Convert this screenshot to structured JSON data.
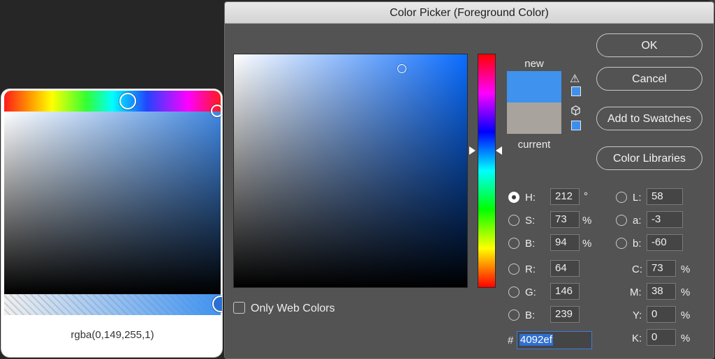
{
  "popover": {
    "value_text": "rgba(0,149,255,1)"
  },
  "dialog": {
    "title": "Color Picker (Foreground Color)",
    "buttons": {
      "ok": "OK",
      "cancel": "Cancel",
      "add_to_swatches": "Add to Swatches",
      "color_libraries": "Color Libraries"
    },
    "swatch": {
      "new_label": "new",
      "current_label": "current",
      "new_color": "#4092ef",
      "current_color": "#a8a49d"
    },
    "icons": {
      "gamut_warning": "warning-triangle-icon",
      "web_safe": "cube-icon"
    },
    "hsb": {
      "h_label": "H:",
      "h_value": "212",
      "h_unit": "°",
      "s_label": "S:",
      "s_value": "73",
      "s_unit": "%",
      "b_label": "B:",
      "b_value": "94",
      "b_unit": "%"
    },
    "rgb": {
      "r_label": "R:",
      "r_value": "64",
      "g_label": "G:",
      "g_value": "146",
      "b_label": "B:",
      "b_value": "239"
    },
    "lab": {
      "l_label": "L:",
      "l_value": "58",
      "a_label": "a:",
      "a_value": "-3",
      "b_label": "b:",
      "b_value": "-60"
    },
    "cmyk": {
      "c_label": "C:",
      "c_value": "73",
      "c_unit": "%",
      "m_label": "M:",
      "m_value": "38",
      "m_unit": "%",
      "y_label": "Y:",
      "y_value": "0",
      "y_unit": "%",
      "k_label": "K:",
      "k_value": "0",
      "k_unit": "%"
    },
    "hex": {
      "hash": "#",
      "value": "4092ef"
    },
    "only_web_colors": "Only Web Colors"
  }
}
